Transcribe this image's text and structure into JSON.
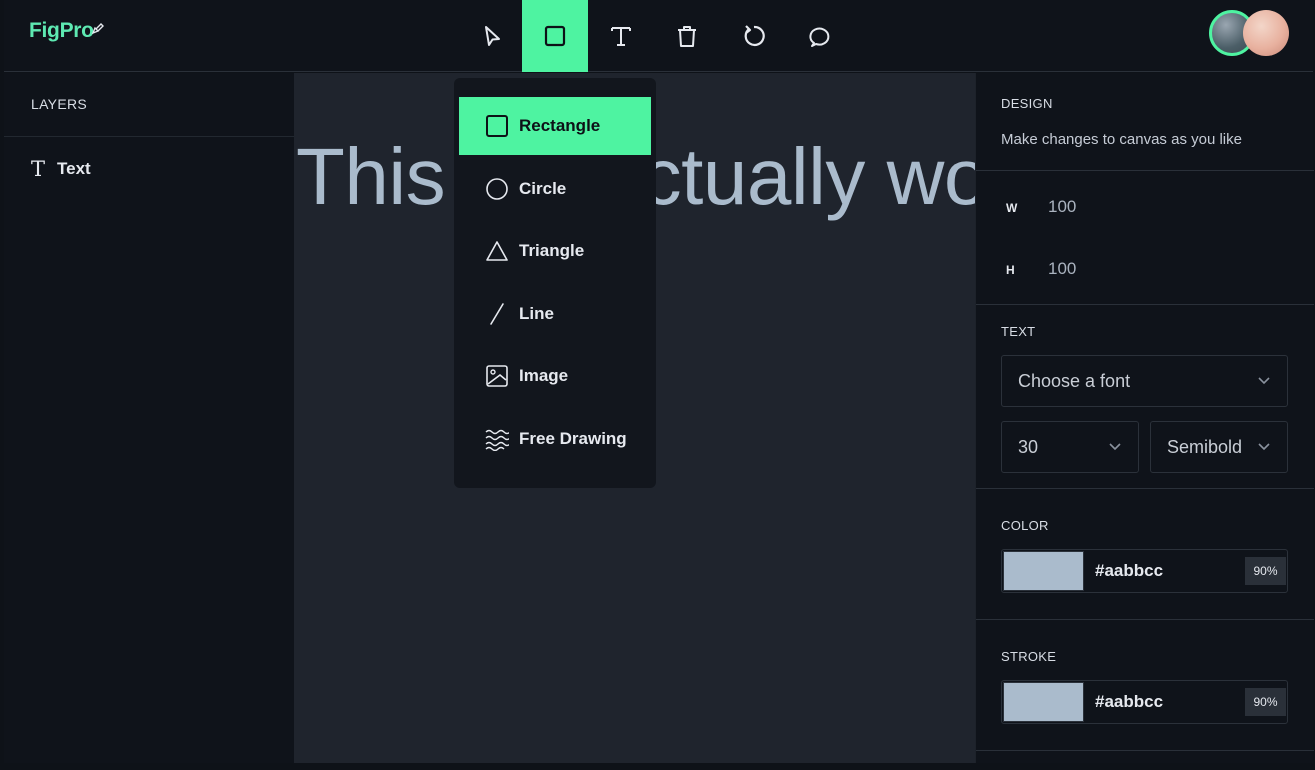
{
  "app": {
    "logo": "FigPro"
  },
  "toolbar": {
    "tools": [
      {
        "name": "select",
        "icon": "cursor-arrow-icon"
      },
      {
        "name": "shapes",
        "icon": "square-icon",
        "active": true
      },
      {
        "name": "text",
        "icon": "text-t-icon"
      },
      {
        "name": "delete",
        "icon": "trash-icon"
      },
      {
        "name": "reset",
        "icon": "rotate-icon"
      },
      {
        "name": "comments",
        "icon": "comment-bubble-icon"
      }
    ],
    "accent_color": "#4ef3a1"
  },
  "layers": {
    "title": "LAYERS",
    "items": [
      {
        "icon": "T",
        "label": "Text"
      }
    ]
  },
  "canvas": {
    "text": "This will actually work!",
    "text_color": "#aabbcc"
  },
  "shapes_menu": {
    "items": [
      {
        "label": "Rectangle",
        "icon": "rectangle-icon",
        "active": true
      },
      {
        "label": "Circle",
        "icon": "circle-icon"
      },
      {
        "label": "Triangle",
        "icon": "triangle-icon"
      },
      {
        "label": "Line",
        "icon": "line-icon"
      },
      {
        "label": "Image",
        "icon": "image-icon"
      },
      {
        "label": "Free Drawing",
        "icon": "free-drawing-icon"
      }
    ]
  },
  "design": {
    "title": "DESIGN",
    "subtitle": "Make changes to canvas as you like",
    "width_label": "W",
    "width_value": "100",
    "height_label": "H",
    "height_value": "100"
  },
  "text_settings": {
    "title": "TEXT",
    "font_placeholder": "Choose a font",
    "font_size": "30",
    "font_weight": "Semibold"
  },
  "color": {
    "title": "COLOR",
    "hex": "#aabbcc",
    "opacity": "90%"
  },
  "stroke": {
    "title": "STROKE",
    "hex": "#aabbcc",
    "opacity": "90%"
  }
}
